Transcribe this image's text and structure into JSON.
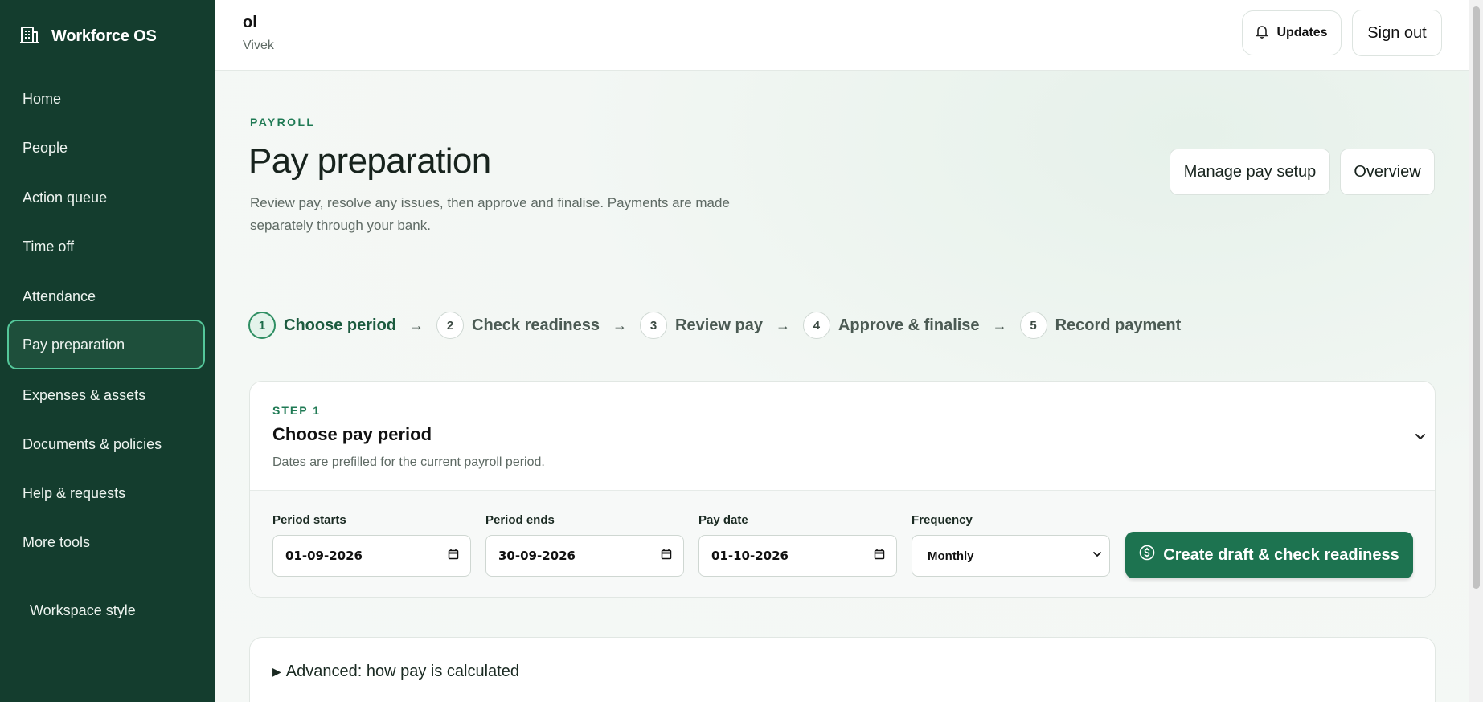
{
  "brand": {
    "name": "Workforce OS",
    "icon": "building-icon"
  },
  "nav": {
    "items": [
      {
        "label": "Home"
      },
      {
        "label": "People"
      },
      {
        "label": "Action queue"
      },
      {
        "label": "Time off"
      },
      {
        "label": "Attendance"
      },
      {
        "label": "Pay preparation",
        "active": true
      },
      {
        "label": "Expenses & assets"
      },
      {
        "label": "Documents & policies"
      },
      {
        "label": "Help & requests"
      },
      {
        "label": "More tools"
      }
    ],
    "workspace_style": "Workspace style"
  },
  "header": {
    "org": "ol",
    "user": "Vivek",
    "updates_label": "Updates",
    "updates_icon": "bell-icon",
    "signout_label": "Sign out"
  },
  "page": {
    "eyebrow": "PAYROLL",
    "title": "Pay preparation",
    "description": "Review pay, resolve any issues, then approve and finalise. Payments are made separately through your bank.",
    "manage_label": "Manage pay setup",
    "overview_label": "Overview"
  },
  "stepper": {
    "steps": [
      {
        "num": "1",
        "label": "Choose period",
        "active": true
      },
      {
        "num": "2",
        "label": "Check readiness"
      },
      {
        "num": "3",
        "label": "Review pay"
      },
      {
        "num": "4",
        "label": "Approve & finalise"
      },
      {
        "num": "5",
        "label": "Record payment"
      }
    ],
    "arrow": "→"
  },
  "period_card": {
    "eyebrow": "STEP 1",
    "title": "Choose pay period",
    "subtitle": "Dates are prefilled for the current payroll period.",
    "fields": {
      "start": {
        "label": "Period starts",
        "value": "01-09-2026"
      },
      "end": {
        "label": "Period ends",
        "value": "30-09-2026"
      },
      "pay_date": {
        "label": "Pay date",
        "value": "01-10-2026"
      },
      "frequency": {
        "label": "Frequency",
        "value": "Monthly"
      }
    },
    "create_label": "Create draft & check readiness"
  },
  "advanced": {
    "label": "Advanced: how pay is calculated",
    "marker": "▶"
  },
  "colors": {
    "sidebar": "#143d2e",
    "accent": "#1d7350",
    "active_border": "#54c79a"
  }
}
